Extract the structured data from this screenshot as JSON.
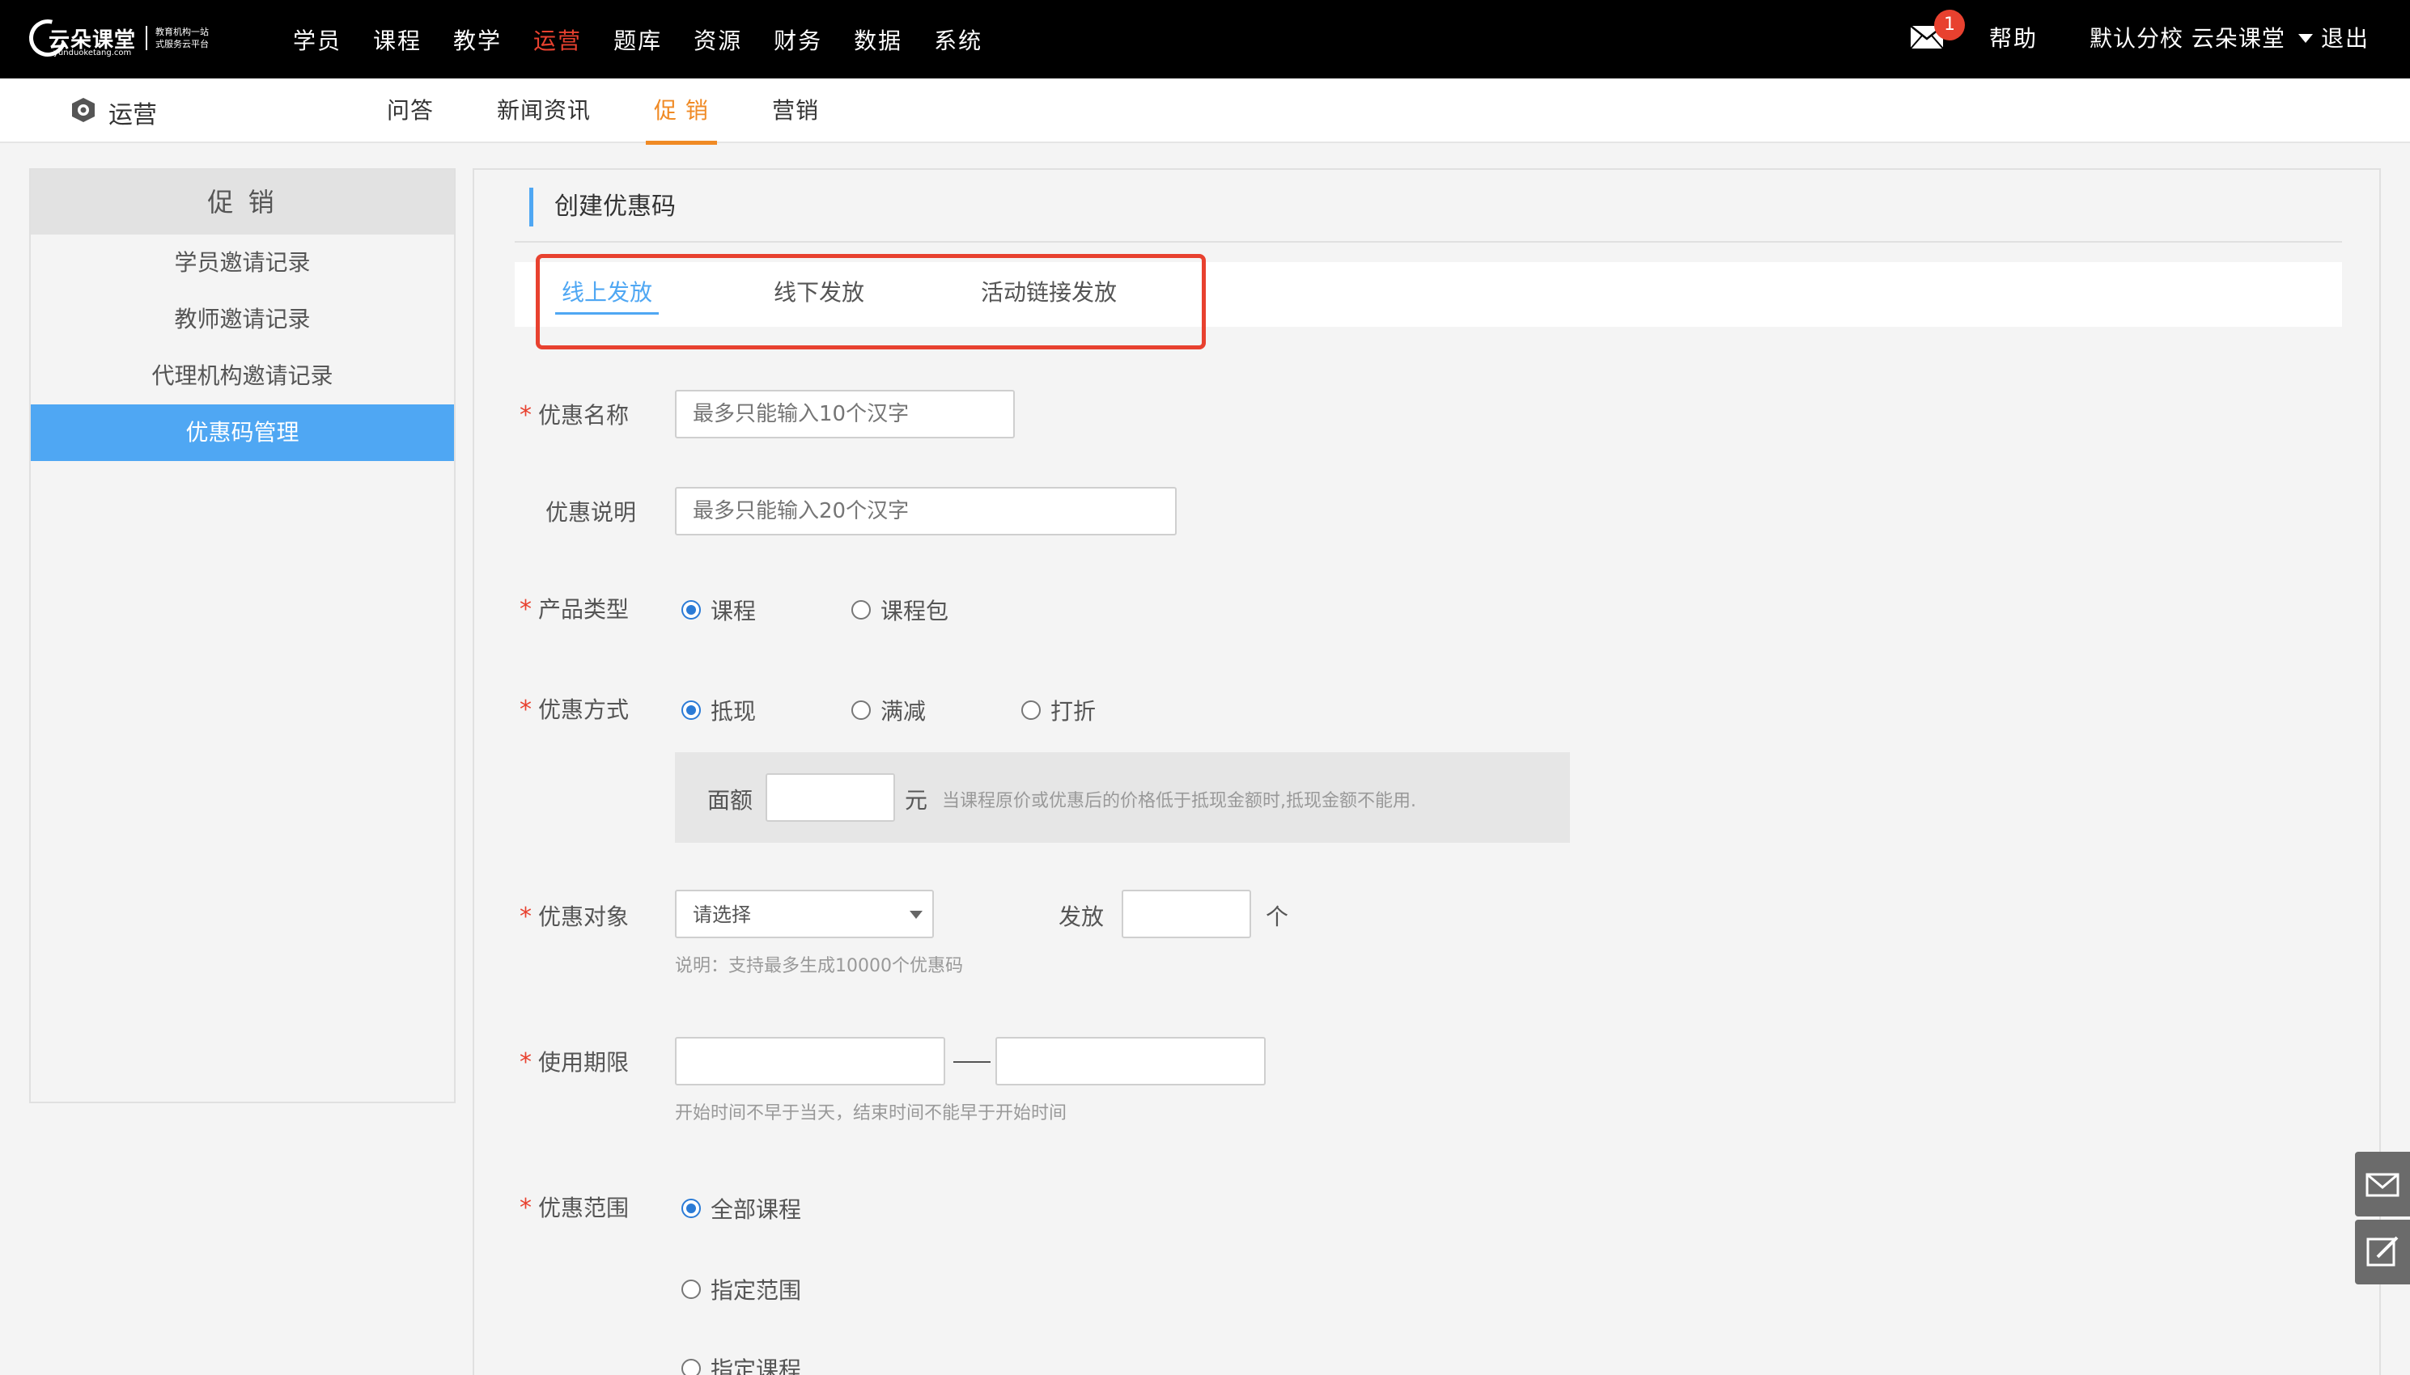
{
  "brand": {
    "name": "云朵课堂",
    "tagline_1": "教育机构一站",
    "tagline_2": "式服务云平台",
    "url": "yunduoketang.com"
  },
  "topnav": {
    "items": [
      "学员",
      "课程",
      "教学",
      "运营",
      "题库",
      "资源",
      "财务",
      "数据",
      "系统"
    ],
    "active_index": 3,
    "mail_count": "1",
    "help": "帮助",
    "branch": "默认分校 云朵课堂",
    "logout": "退出"
  },
  "subnav": {
    "section_title": "运营",
    "items": [
      "问答",
      "新闻资讯",
      "促 销",
      "营销"
    ],
    "active_index": 2
  },
  "sidebar": {
    "header": "促 销",
    "items": [
      "学员邀请记录",
      "教师邀请记录",
      "代理机构邀请记录",
      "优惠码管理"
    ],
    "active_index": 3
  },
  "form": {
    "title": "创建优惠码",
    "tabs": [
      "线上发放",
      "线下发放",
      "活动链接发放"
    ],
    "active_tab": 0,
    "name_label": "优惠名称",
    "name_placeholder": "最多只能输入10个汉字",
    "desc_label": "优惠说明",
    "desc_placeholder": "最多只能输入20个汉字",
    "product_label": "产品类型",
    "product_options": [
      "课程",
      "课程包"
    ],
    "discount_label": "优惠方式",
    "discount_options": [
      "抵现",
      "满减",
      "打折"
    ],
    "amount_label": "面额",
    "amount_unit": "元",
    "amount_hint": "当课程原价或优惠后的价格低于抵现金额时,抵现金额不能用.",
    "target_label": "优惠对象",
    "target_select": "请选择",
    "issue_label": "发放",
    "issue_unit": "个",
    "target_hint": "说明：支持最多生成10000个优惠码",
    "period_label": "使用期限",
    "period_hint": "开始时间不早于当天，结束时间不能早于开始时间",
    "scope_label": "优惠范围",
    "scope_options": [
      "全部课程",
      "指定范围",
      "指定课程"
    ]
  },
  "colors": {
    "accent_blue": "#4fa7f3",
    "accent_orange": "#f08a24",
    "accent_red": "#e8412f"
  }
}
